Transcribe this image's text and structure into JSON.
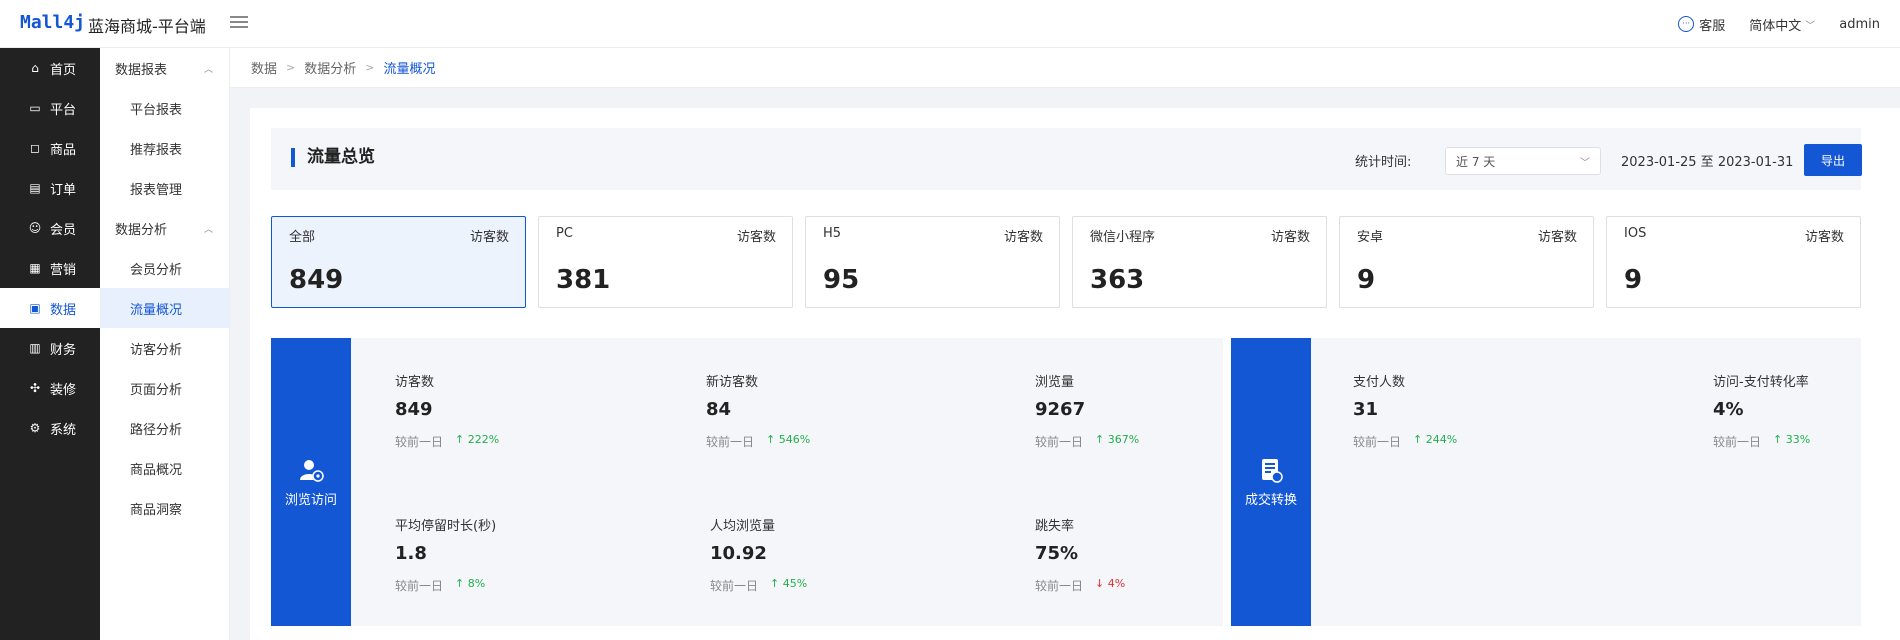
{
  "header": {
    "logo": "Mall4j",
    "title": "蓝海商城-平台端",
    "service": "客服",
    "language": "简体中文",
    "user": "admin"
  },
  "sidebar": {
    "items": [
      {
        "label": "首页",
        "icon": "home-icon"
      },
      {
        "label": "平台",
        "icon": "monitor-icon"
      },
      {
        "label": "商品",
        "icon": "bag-icon"
      },
      {
        "label": "订单",
        "icon": "order-icon"
      },
      {
        "label": "会员",
        "icon": "member-icon"
      },
      {
        "label": "营销",
        "icon": "gift-icon"
      },
      {
        "label": "数据",
        "icon": "chart-icon"
      },
      {
        "label": "财务",
        "icon": "finance-icon"
      },
      {
        "label": "装修",
        "icon": "decorate-icon"
      },
      {
        "label": "系统",
        "icon": "gear-icon"
      }
    ]
  },
  "submenu": {
    "group1": "数据报表",
    "group1_items": [
      "平台报表",
      "推荐报表",
      "报表管理"
    ],
    "group2": "数据分析",
    "group2_items": [
      "会员分析",
      "流量概况",
      "访客分析",
      "页面分析",
      "路径分析",
      "商品概况",
      "商品洞察"
    ]
  },
  "breadcrumb": [
    "数据",
    "数据分析",
    "流量概况"
  ],
  "overview": {
    "title": "流量总览",
    "stat_label": "统计时间:",
    "period": "近 7 天",
    "date_range": "2023-01-25 至 2023-01-31",
    "export": "导出"
  },
  "channels": [
    {
      "name": "全部",
      "metric": "访客数",
      "value": "849"
    },
    {
      "name": "PC",
      "metric": "访客数",
      "value": "381"
    },
    {
      "name": "H5",
      "metric": "访客数",
      "value": "95"
    },
    {
      "name": "微信小程序",
      "metric": "访客数",
      "value": "363"
    },
    {
      "name": "安卓",
      "metric": "访客数",
      "value": "9"
    },
    {
      "name": "IOS",
      "metric": "访客数",
      "value": "9"
    }
  ],
  "browse": {
    "tag": "浏览访问",
    "compare_label": "较前一日",
    "metrics": [
      {
        "label": "访客数",
        "value": "849",
        "change": "↑ 222%",
        "dir": "up"
      },
      {
        "label": "新访客数",
        "value": "84",
        "change": "↑ 546%",
        "dir": "up"
      },
      {
        "label": "浏览量",
        "value": "9267",
        "change": "↑ 367%",
        "dir": "up"
      },
      {
        "label": "平均停留时长(秒)",
        "value": "1.8",
        "change": "↑ 8%",
        "dir": "up"
      },
      {
        "label": "人均浏览量",
        "value": "10.92",
        "change": "↑ 45%",
        "dir": "up"
      },
      {
        "label": "跳失率",
        "value": "75%",
        "change": "↓ 4%",
        "dir": "down"
      }
    ]
  },
  "conversion": {
    "tag": "成交转换",
    "compare_label": "较前一日",
    "metrics": [
      {
        "label": "支付人数",
        "value": "31",
        "change": "↑ 244%",
        "dir": "up"
      },
      {
        "label": "访问-支付转化率",
        "value": "4%",
        "change": "↑ 33%",
        "dir": "up"
      }
    ]
  },
  "colors": {
    "primary": "#1457d5",
    "up": "#21b04c",
    "down": "#e63131",
    "sidebar": "#222222"
  }
}
